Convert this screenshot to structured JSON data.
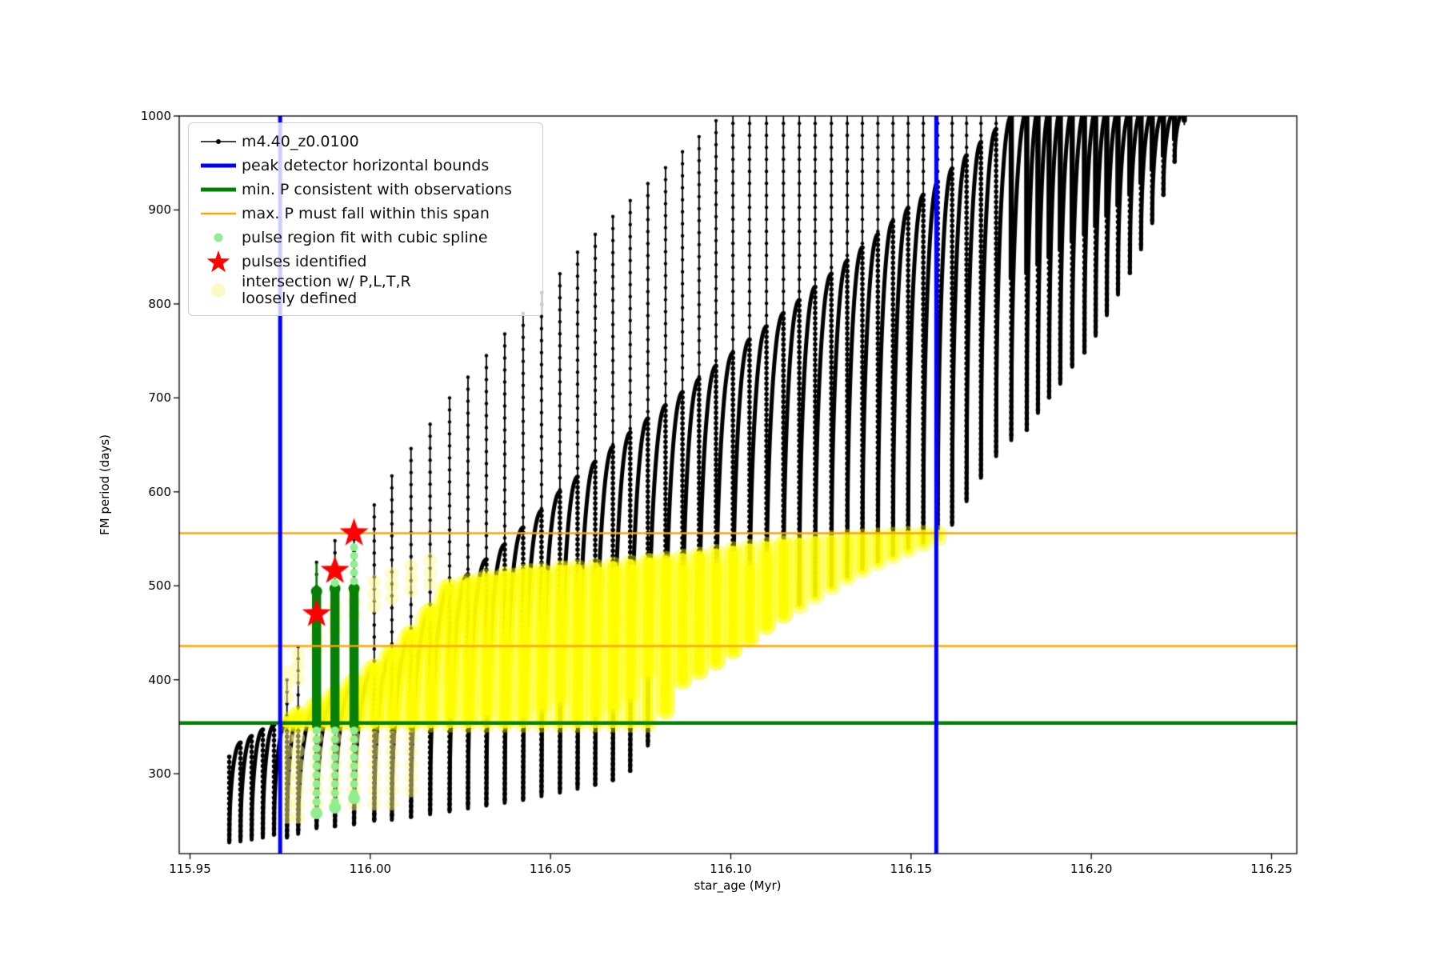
{
  "figure": {
    "background": "#ffffff"
  },
  "axes": {
    "xlabel": "star_age (Myr)",
    "ylabel": "FM period (days)",
    "x_ticks": [
      "115.95",
      "116.00",
      "116.05",
      "116.10",
      "116.15",
      "116.20",
      "116.25"
    ],
    "x_tick_values": [
      115.95,
      116.0,
      116.05,
      116.1,
      116.15,
      116.2,
      116.25
    ],
    "y_ticks": [
      "300",
      "400",
      "500",
      "600",
      "700",
      "800",
      "900",
      "1000"
    ],
    "y_tick_values": [
      300,
      400,
      500,
      600,
      700,
      800,
      900,
      1000
    ]
  },
  "legend": {
    "items": [
      {
        "marker": "line-dot",
        "color": "#000000",
        "label": "m4.40_z0.0100"
      },
      {
        "marker": "thick-line",
        "color": "#0000ff",
        "label": "peak detector horizontal bounds"
      },
      {
        "marker": "thick-line",
        "color": "#008000",
        "label": "min. P consistent with observations"
      },
      {
        "marker": "line",
        "color": "#ffa500",
        "label": "max. P must fall within this span"
      },
      {
        "marker": "dot",
        "color": "#90ee90",
        "label": "pulse region fit with cubic spline"
      },
      {
        "marker": "star",
        "color": "#ff0000",
        "label": "pulses identified"
      },
      {
        "marker": "big-dot",
        "color": "#fafac8",
        "label": "intersection w/ P,L,T,R",
        "label2": "loosely defined"
      }
    ]
  },
  "chart_data": {
    "type": "line",
    "title": "",
    "series_label": "m4.40_z0.0100",
    "xlabel": "star_age (Myr)",
    "ylabel": "FM period (days)",
    "x_range": [
      115.947,
      116.257
    ],
    "y_range": [
      215,
      1000
    ],
    "grid": false,
    "legend_position": "upper left",
    "pulses_comment": "each entry = one thermal-pulse boundary: [star_age_Myr, dip_minimum_days, dense_arc_top_days, thin_spike_top_days]; values >1000 are clipped by the axes",
    "pulses": [
      [
        115.9609,
        227,
        318,
        318
      ],
      [
        115.964,
        228,
        333,
        333
      ],
      [
        115.9671,
        230,
        340,
        340
      ],
      [
        115.9702,
        232,
        347,
        347
      ],
      [
        115.9733,
        235,
        352,
        352
      ],
      [
        115.9769,
        232,
        356,
        400
      ],
      [
        115.98,
        236,
        362,
        435
      ],
      [
        115.9851,
        242,
        372,
        525
      ],
      [
        115.9902,
        244,
        383,
        548
      ],
      [
        115.9955,
        246,
        397,
        562
      ],
      [
        116.0011,
        250,
        412,
        586
      ],
      [
        116.006,
        251,
        428,
        617
      ],
      [
        116.0113,
        254,
        448,
        646
      ],
      [
        116.0166,
        257,
        472,
        672
      ],
      [
        116.022,
        260,
        500,
        700
      ],
      [
        116.0271,
        263,
        512,
        722
      ],
      [
        116.0322,
        266,
        528,
        745
      ],
      [
        116.0373,
        269,
        544,
        768
      ],
      [
        116.0424,
        272,
        562,
        790
      ],
      [
        116.0475,
        276,
        580,
        812
      ],
      [
        116.0526,
        280,
        600,
        832
      ],
      [
        116.0575,
        284,
        616,
        855
      ],
      [
        116.0624,
        288,
        632,
        874
      ],
      [
        116.0673,
        293,
        648,
        893
      ],
      [
        116.0721,
        303,
        663,
        910
      ],
      [
        116.077,
        330,
        678,
        928
      ],
      [
        116.0819,
        368,
        692,
        945
      ],
      [
        116.0866,
        400,
        706,
        962
      ],
      [
        116.0912,
        410,
        720,
        978
      ],
      [
        116.0959,
        420,
        734,
        995
      ],
      [
        116.1006,
        432,
        748,
        1005
      ],
      [
        116.1052,
        444,
        762,
        1005
      ],
      [
        116.1099,
        458,
        776,
        1005
      ],
      [
        116.1146,
        470,
        790,
        1005
      ],
      [
        116.119,
        480,
        804,
        1005
      ],
      [
        116.1234,
        490,
        818,
        1005
      ],
      [
        116.1279,
        500,
        832,
        1005
      ],
      [
        116.1323,
        510,
        846,
        1005
      ],
      [
        116.1365,
        518,
        860,
        1005
      ],
      [
        116.1408,
        526,
        874,
        1005
      ],
      [
        116.145,
        533,
        888,
        1005
      ],
      [
        116.1492,
        540,
        902,
        1005
      ],
      [
        116.1534,
        546,
        916,
        1005
      ],
      [
        116.1574,
        552,
        930,
        1005
      ],
      [
        116.1614,
        565,
        944,
        1005
      ],
      [
        116.1654,
        590,
        958,
        1005
      ],
      [
        116.1694,
        615,
        972,
        1005
      ],
      [
        116.1736,
        638,
        986,
        1005
      ],
      [
        116.1778,
        655,
        1000,
        1005
      ],
      [
        116.1821,
        666,
        1005,
        1005
      ],
      [
        116.1852,
        684,
        1005,
        1005
      ],
      [
        116.1883,
        700,
        1005,
        1005
      ],
      [
        116.1914,
        715,
        1005,
        1005
      ],
      [
        116.1947,
        733,
        1005,
        1005
      ],
      [
        116.1981,
        748,
        1005,
        1005
      ],
      [
        116.2012,
        766,
        1005,
        1005
      ],
      [
        116.2043,
        788,
        1005,
        1005
      ],
      [
        116.2074,
        810,
        1005,
        1005
      ],
      [
        116.2107,
        833,
        1005,
        1005
      ],
      [
        116.2138,
        858,
        1005,
        1005
      ],
      [
        116.2169,
        886,
        1005,
        1005
      ],
      [
        116.22,
        916,
        1005,
        1005
      ],
      [
        116.2231,
        951,
        1005,
        1005
      ],
      [
        116.2258,
        991,
        1005,
        1005
      ]
    ],
    "hlines": {
      "min_P_consistent_days": 354,
      "max_P_span_days": [
        436,
        556
      ]
    },
    "vlines": {
      "peak_detector_bounds_Myr": [
        115.975,
        116.157
      ]
    },
    "yellow_region": {
      "label": "intersection w/ P,L,T,R loosely defined",
      "x_range": [
        115.976,
        116.159
      ],
      "bottom_days": 354,
      "top_envelope": [
        [
          115.977,
          372
        ],
        [
          115.985,
          422
        ],
        [
          115.99,
          442
        ],
        [
          115.9955,
          460
        ],
        [
          116.001,
          468
        ],
        [
          116.006,
          477
        ],
        [
          116.0113,
          485
        ],
        [
          116.0166,
          492
        ],
        [
          116.022,
          498
        ],
        [
          116.032,
          508
        ],
        [
          116.042,
          513
        ],
        [
          116.052,
          517
        ],
        [
          116.062,
          519
        ],
        [
          116.072,
          523
        ],
        [
          116.082,
          527
        ],
        [
          116.092,
          532
        ],
        [
          116.102,
          538
        ],
        [
          116.112,
          543
        ],
        [
          116.122,
          547
        ],
        [
          116.132,
          550
        ],
        [
          116.142,
          552
        ],
        [
          116.152,
          554
        ],
        [
          116.159,
          555
        ]
      ]
    },
    "pulse_columns": {
      "label": "pulse region fit with cubic spline",
      "columns": [
        {
          "x": 115.9851,
          "top": 497,
          "bottom": 354,
          "tail_bottom": 258,
          "thin_line_to": 523,
          "dots_above": null
        },
        {
          "x": 115.9902,
          "top": 500,
          "bottom": 354,
          "tail_bottom": 264,
          "thin_line_to": null,
          "dots_above": [
            503,
            527
          ]
        },
        {
          "x": 115.9955,
          "top": 500,
          "bottom": 354,
          "tail_bottom": 274,
          "thin_line_to": null,
          "dots_above": [
            505,
            543
          ]
        }
      ]
    },
    "stars": {
      "label": "pulses identified",
      "points": [
        [
          115.9851,
          470
        ],
        [
          115.9902,
          516
        ],
        [
          115.9955,
          556
        ]
      ]
    },
    "colors": {
      "series": "#000000",
      "peak_bounds": "#0000ff",
      "min_P": "#008000",
      "max_P_span": "#ffa500",
      "pulse_region_fit": "#90ee90",
      "pulse_region_dark": "#068006",
      "pulses_identified": "#ff0000",
      "intersection": "#ffff00"
    }
  }
}
